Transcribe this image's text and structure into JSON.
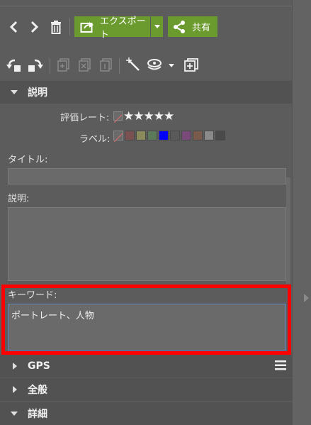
{
  "toolbar": {
    "back_icon": "chevron-left-icon",
    "forward_icon": "chevron-right-icon",
    "delete_icon": "trash-icon",
    "export_label": "エクスポート",
    "share_label": "共有",
    "accent_color": "#6b9a2f"
  },
  "sections": {
    "description_title": "説明",
    "gps_title": "GPS",
    "general_title": "全般",
    "details_title": "詳細"
  },
  "fields": {
    "rating_label": "評価レート:",
    "rating_stars": "★★★★★",
    "label_label": "ラベル:",
    "label_colors": [
      "#7a5050",
      "#8a8a5a",
      "#5a7a5a",
      "#0000ff",
      "#5a5a5a",
      "#7a4a7a",
      "#7a5a4a",
      "#8a8a8a",
      "#4a4a4a"
    ],
    "title_label": "タイトル:",
    "title_value": "",
    "description_label": "説明:",
    "description_value": "",
    "keywords_label": "キーワード:",
    "keywords_value": "ポートレート、人物"
  },
  "highlight_color": "#ff0000"
}
